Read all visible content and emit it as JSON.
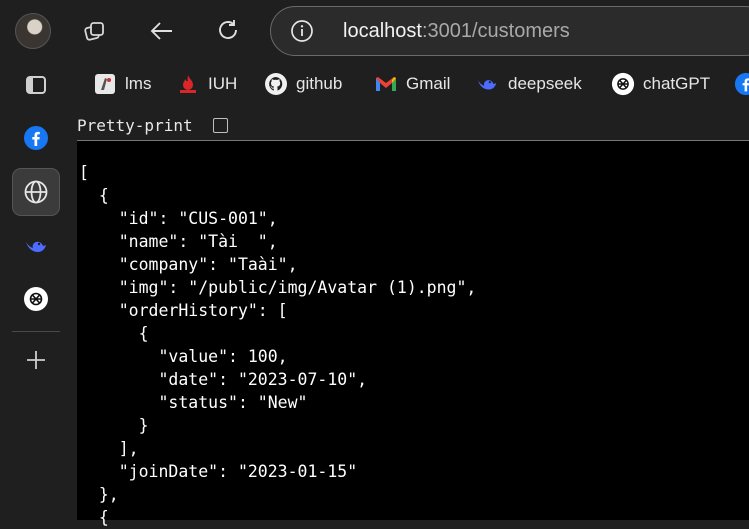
{
  "address": {
    "host": "localhost",
    "rest": ":3001/customers"
  },
  "bookmarks": [
    {
      "label": "lms",
      "icon": "lms-icon"
    },
    {
      "label": "IUH",
      "icon": "iuh-icon"
    },
    {
      "label": "github",
      "icon": "github-icon"
    },
    {
      "label": "Gmail",
      "icon": "gmail-icon"
    },
    {
      "label": "deepseek",
      "icon": "deepseek-icon"
    },
    {
      "label": "chatGPT",
      "icon": "chatgpt-icon"
    }
  ],
  "viewer": {
    "pretty_print_label": "Pretty-print",
    "json_lines": [
      "[",
      "  {",
      "    \"id\": \"CUS-001\",",
      "    \"name\": \"Tài  \",",
      "    \"company\": \"Taài\",",
      "    \"img\": \"/public/img/Avatar (1).png\",",
      "    \"orderHistory\": [",
      "      {",
      "        \"value\": 100,",
      "        \"date\": \"2023-07-10\",",
      "        \"status\": \"New\"",
      "      }",
      "    ],",
      "    \"joinDate\": \"2023-01-15\"",
      "  },",
      "  {"
    ]
  },
  "colors": {
    "accent_facebook": "#1877f2",
    "accent_deepseek": "#4d6bfe",
    "background": "#000000"
  }
}
